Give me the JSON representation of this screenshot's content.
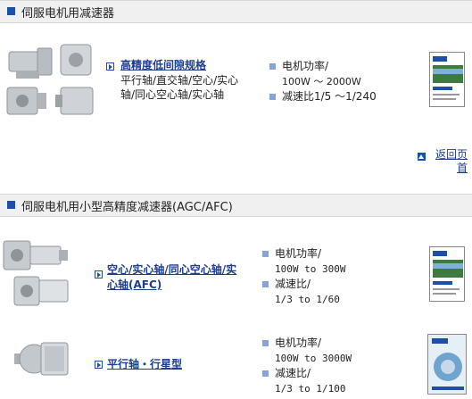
{
  "section1": {
    "title": "伺服电机用减速器",
    "product": {
      "link": "高精度低间隙规格",
      "desc_line1": "平行轴/直交轴/空心/实心",
      "desc_line2": "轴/同心空心轴/实心轴",
      "spec1_label": "电机功率/",
      "spec1_value": "100W ～ 2000W",
      "spec2_label": "减速比1/5 ～1/240"
    },
    "back_label_1": "返回页",
    "back_label_2": "首"
  },
  "section2": {
    "title": "伺服电机用小型高精度减速器(AGC/AFC)",
    "product1": {
      "link_line1": "空心/实心轴/同心空心轴/实",
      "link_line2": "心轴(AFC)",
      "spec1_label": "电机功率/",
      "spec1_value": "100W to 300W",
      "spec2_label": "减速比/",
      "spec2_value": "1/3 to 1/60"
    },
    "product2": {
      "link": "平行轴・行星型",
      "spec1_label": "电机功率/",
      "spec1_value": "100W to 3000W",
      "spec2_label": "减速比/",
      "spec2_value": "1/3 to 1/100"
    }
  },
  "colors": {
    "accent": "#1e4fa8",
    "link": "#1e3d8f",
    "bullet": "#8aa3d6",
    "header_bg": "#f0f0f0"
  }
}
